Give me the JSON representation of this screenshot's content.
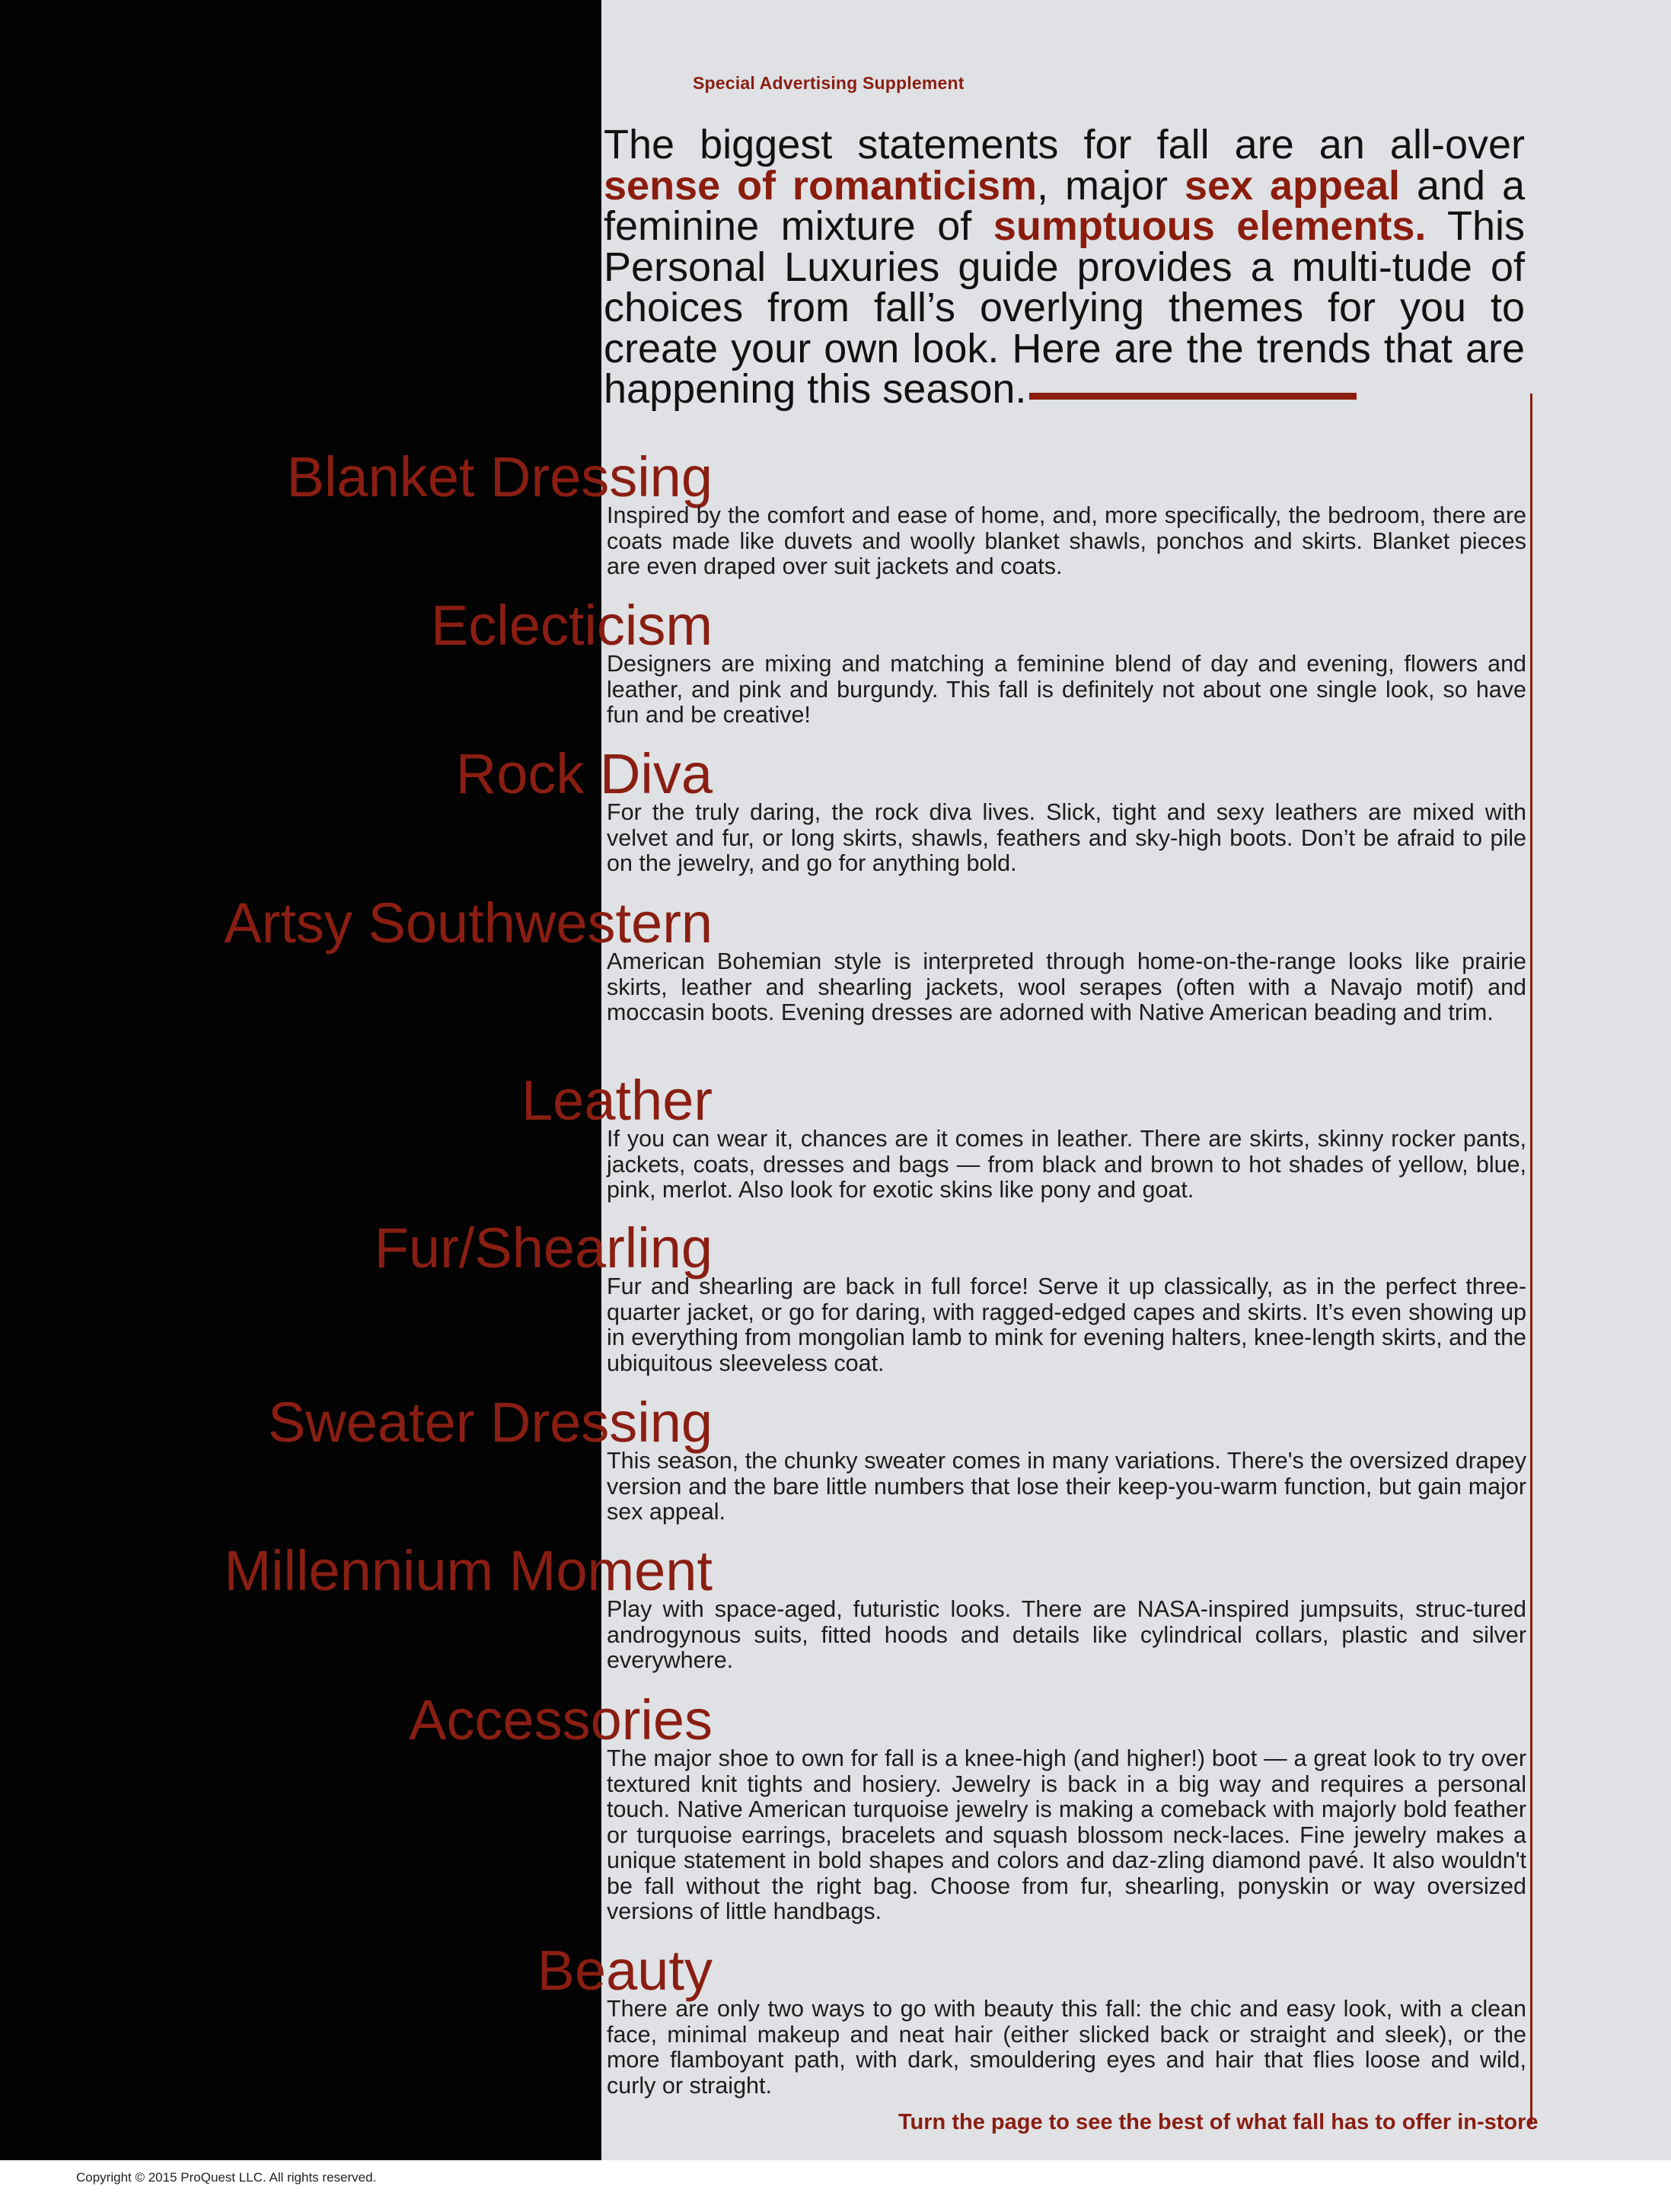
{
  "header": {
    "supplement_label": "Special Advertising Supplement"
  },
  "intro": {
    "t1": "The biggest statements for fall are an all-over ",
    "h1": "sense of romanticism",
    "t2": ", major ",
    "h2": "sex appeal",
    "t3": " and a feminine mixture of ",
    "h3": "sumptuous elements.",
    "t4": " This Personal Luxuries guide provides a multi-tude of choices from fall’s overlying themes for you to create your own look. Here are the trends that are happening this season."
  },
  "trends": [
    {
      "title": "Blanket Dressing",
      "body": "Inspired by the comfort and ease of home, and, more specifically, the bedroom, there are coats made like duvets and woolly blanket shawls, ponchos and skirts. Blanket pieces are even draped over suit jackets and coats."
    },
    {
      "title": "Eclecticism",
      "body": "Designers are mixing and matching a feminine blend of day and evening, flowers and leather, and pink and burgundy. This fall is definitely not about one single look, so have fun and be creative!"
    },
    {
      "title": "Rock Diva",
      "body": "For the truly daring, the rock diva lives. Slick, tight and sexy leathers are mixed with velvet and fur, or long skirts, shawls, feathers and sky-high boots. Don’t be afraid to pile on the jewelry, and go for anything bold."
    },
    {
      "title": "Artsy Southwestern",
      "body": "American Bohemian style is interpreted through home-on-the-range looks like prairie skirts, leather and shearling jackets, wool serapes (often with a Navajo motif) and moccasin boots. Evening dresses are adorned with Native American beading and trim."
    },
    {
      "title": "Leather",
      "body": "If you can wear it, chances are it comes in leather. There are skirts, skinny rocker pants, jackets, coats, dresses and bags — from black and brown to hot shades of yellow, blue, pink, merlot. Also look for exotic skins like pony and goat."
    },
    {
      "title": "Fur/Shearling",
      "body": "Fur and shearling are back in full force! Serve it up classically, as in the perfect three-quarter jacket, or go for daring, with ragged-edged capes and skirts. It’s even showing up in everything from mongolian lamb to mink for evening halters, knee-length skirts, and the ubiquitous sleeveless coat."
    },
    {
      "title": "Sweater Dressing",
      "body": "This season, the chunky sweater comes in many variations. There's the oversized drapey version and the bare little numbers that lose their keep-you-warm function, but gain major sex appeal."
    },
    {
      "title": "Millennium Moment",
      "body": "Play with space-aged, futuristic looks. There are NASA-inspired jumpsuits, struc-tured androgynous suits, fitted hoods and details like cylindrical collars, plastic and silver everywhere."
    },
    {
      "title": "Accessories",
      "body": "The major shoe to own for fall is a knee-high (and higher!) boot — a great look to try over textured knit tights and hosiery. Jewelry is back in a big way and requires a personal touch. Native American turquoise jewelry is making a comeback with majorly bold feather or turquoise earrings, bracelets and squash blossom neck-laces. Fine jewelry makes a unique statement in bold shapes and colors and daz-zling diamond pavé. It also wouldn't be fall without the right bag. Choose from fur, shearling, ponyskin or way oversized versions of little handbags."
    },
    {
      "title": "Beauty",
      "body": "There are only two ways to go with beauty this fall: the chic and easy look, with a clean face, minimal makeup and neat hair (either slicked back or straight and sleek), or the more flamboyant path, with dark, smouldering eyes and hair that flies loose and wild, curly or straight."
    }
  ],
  "footer": {
    "cta": "Turn the page to see the best of what fall has to offer in-store",
    "copyright": "Copyright © 2015 ProQuest LLC. All rights reserved."
  },
  "colors": {
    "accent": "#8b1d0e",
    "panel": "#030303",
    "paper": "#dfe1e4"
  }
}
